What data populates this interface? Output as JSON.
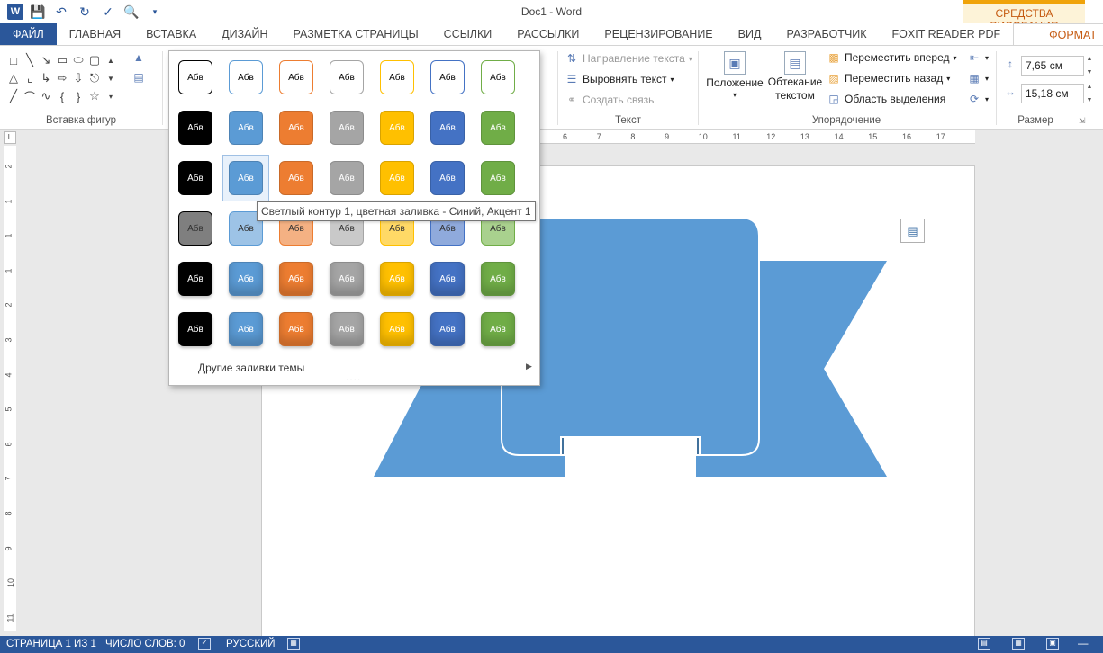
{
  "window": {
    "title": "Doc1 - Word",
    "contextual_tab_group": "СРЕДСТВА РИСОВАНИЯ"
  },
  "tabs": [
    "ФАЙЛ",
    "ГЛАВНАЯ",
    "ВСТАВКА",
    "ДИЗАЙН",
    "РАЗМЕТКА СТРАНИЦЫ",
    "ССЫЛКИ",
    "РАССЫЛКИ",
    "РЕЦЕНЗИРОВАНИЕ",
    "ВИД",
    "РАЗРАБОТЧИК",
    "FOXIT READER PDF",
    "ФОРМАТ"
  ],
  "ribbon": {
    "insert_shapes_label": "Вставка фигур",
    "text_group": {
      "label": "Текст",
      "text_direction": "Направление текста",
      "align_text": "Выровнять текст",
      "create_link": "Создать связь"
    },
    "arrange_group": {
      "label": "Упорядочение",
      "position_line1": "Положение",
      "wrap_line1": "Обтекание",
      "wrap_line2": "текстом",
      "bring_forward": "Переместить вперед",
      "send_backward": "Переместить назад",
      "selection_pane": "Область выделения"
    },
    "size_group": {
      "label": "Размер",
      "height": "7,65 см",
      "width": "15,18 см"
    }
  },
  "gallery": {
    "swatch_label": "Абв",
    "rows": [
      [
        "#ffffff",
        "#ffffff",
        "#ffffff",
        "#ffffff",
        "#ffffff",
        "#ffffff",
        "#ffffff"
      ],
      [
        "#000000",
        "#5b9bd5",
        "#ed7d31",
        "#a5a5a5",
        "#ffc000",
        "#4472c4",
        "#70ad47"
      ],
      [
        "#000000",
        "#5b9bd5",
        "#ed7d31",
        "#a5a5a5",
        "#ffc000",
        "#4472c4",
        "#70ad47"
      ],
      [
        "#7f7f7f",
        "#9dc3e6",
        "#f4b183",
        "#c9c9c9",
        "#ffd966",
        "#8faadc",
        "#a9d18e"
      ],
      [
        "#000000",
        "#5b9bd5",
        "#ed7d31",
        "#a5a5a5",
        "#ffc000",
        "#4472c4",
        "#70ad47"
      ],
      [
        "#000000",
        "#5b9bd5",
        "#ed7d31",
        "#a5a5a5",
        "#ffc000",
        "#4472c4",
        "#70ad47"
      ]
    ],
    "outline_colors": [
      "#000000",
      "#5b9bd5",
      "#ed7d31",
      "#a5a5a5",
      "#ffc000",
      "#4472c4",
      "#70ad47"
    ],
    "hovered_row": 2,
    "hovered_col": 1,
    "more_fills": "Другие заливки темы",
    "tooltip": "Светлый контур 1, цветная заливка - Синий, Акцент 1"
  },
  "ruler": {
    "h_ticks": [
      "6",
      "7",
      "8",
      "9",
      "10",
      "11",
      "12",
      "13",
      "14",
      "15",
      "16",
      "17"
    ],
    "v_ticks": [
      "2",
      "1",
      "1",
      "1",
      "2",
      "3",
      "4",
      "5",
      "6",
      "7",
      "8",
      "9",
      "10",
      "11"
    ]
  },
  "shape": {
    "fill": "#5b9bd5",
    "fold": "#41719c",
    "outline": "#ffffff"
  },
  "statusbar": {
    "page": "СТРАНИЦА 1 ИЗ 1",
    "words": "ЧИСЛО СЛОВ: 0",
    "language": "РУССКИЙ"
  }
}
